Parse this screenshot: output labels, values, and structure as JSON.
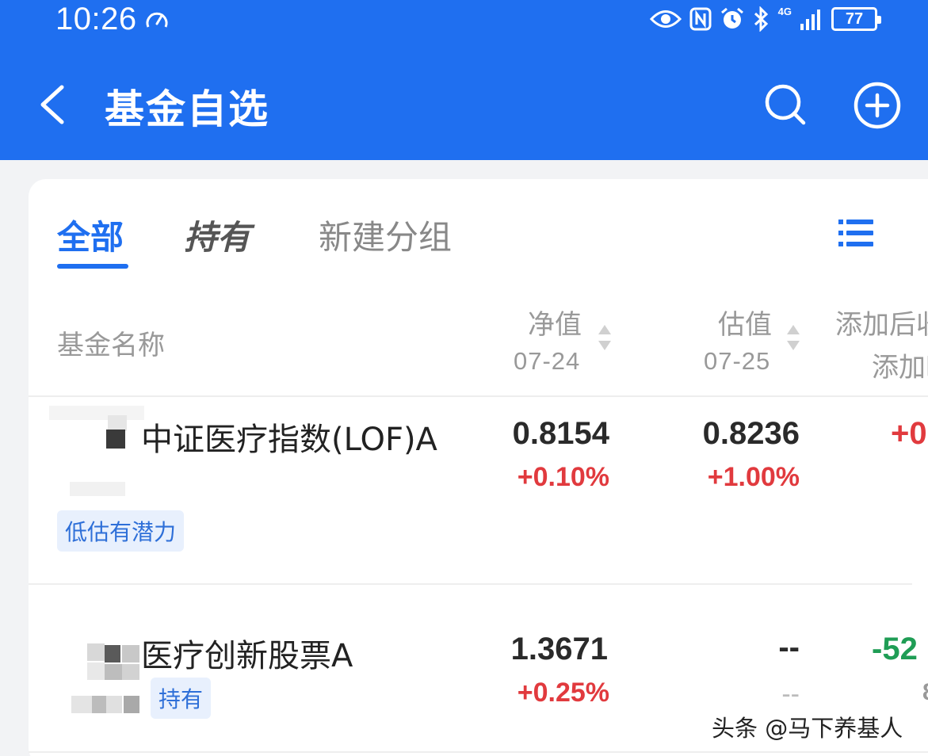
{
  "status_bar": {
    "time": "10:26",
    "battery": "77",
    "network": "4G"
  },
  "header": {
    "title": "基金自选",
    "background": "#1f6ff0"
  },
  "tabs": [
    {
      "label": "全部",
      "active": true
    },
    {
      "label": "持有",
      "active": false
    },
    {
      "label": "新建分组",
      "active": false
    }
  ],
  "columns": {
    "name": "基金名称",
    "nav": {
      "label": "净值",
      "date": "07-24"
    },
    "estimate": {
      "label": "估值",
      "date": "07-25"
    },
    "after_add": {
      "label": "添加后收",
      "sub": "添加时"
    }
  },
  "funds": [
    {
      "name": "中证医疗指数(LOF)A",
      "nav": "0.8154",
      "nav_change": "+0.10%",
      "estimate": "0.8236",
      "estimate_change": "+1.00%",
      "after_add": "+0",
      "tag": "低估有潜力"
    },
    {
      "name": "医疗创新股票A",
      "nav": "1.3671",
      "nav_change": "+0.25%",
      "estimate": "--",
      "estimate_change": "--",
      "after_add": "-52",
      "after_add_sub": "8",
      "tag": "持有"
    }
  ],
  "watermark": "头条 @马下养基人",
  "colors": {
    "accent": "#1f6ff0",
    "rise": "#e13a3e",
    "fall": "#1f9d55"
  }
}
